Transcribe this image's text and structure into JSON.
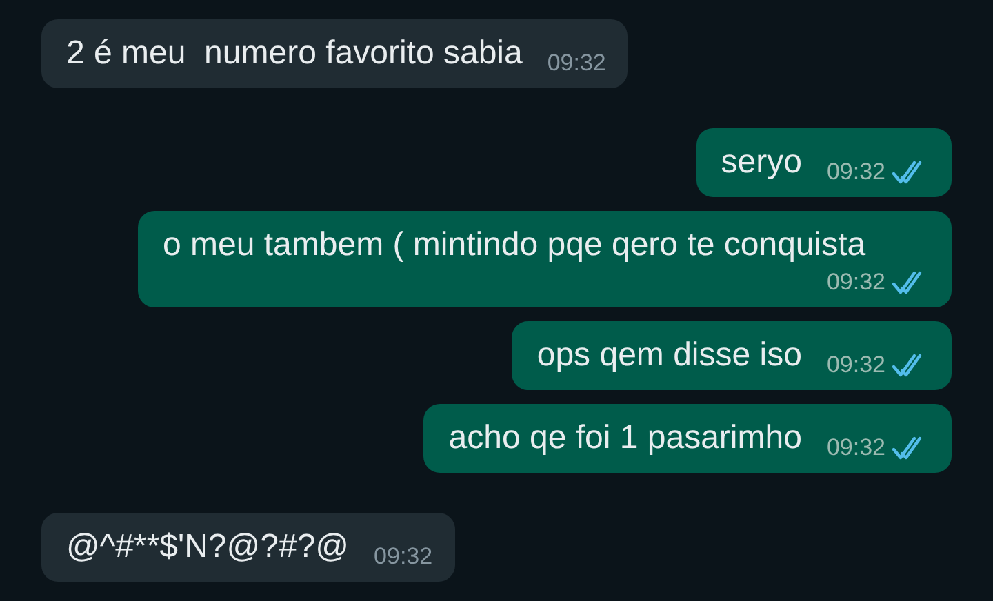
{
  "messages": [
    {
      "kind": "incoming",
      "text": "2 é meu  numero favorito sabia",
      "time": "09:32"
    },
    {
      "kind": "outgoing",
      "text": "seryo",
      "time": "09:32",
      "read": true
    },
    {
      "kind": "outgoing",
      "text": "o meu tambem ( mintindo pqe qero te conquista",
      "time": "09:32",
      "read": true
    },
    {
      "kind": "outgoing",
      "text": "ops qem disse iso",
      "time": "09:32",
      "read": true
    },
    {
      "kind": "outgoing",
      "text": "acho qe foi 1 pasarimho",
      "time": "09:32",
      "read": true
    },
    {
      "kind": "incoming",
      "text": "@^#**$'N?@?#?@",
      "time": "09:32"
    }
  ]
}
